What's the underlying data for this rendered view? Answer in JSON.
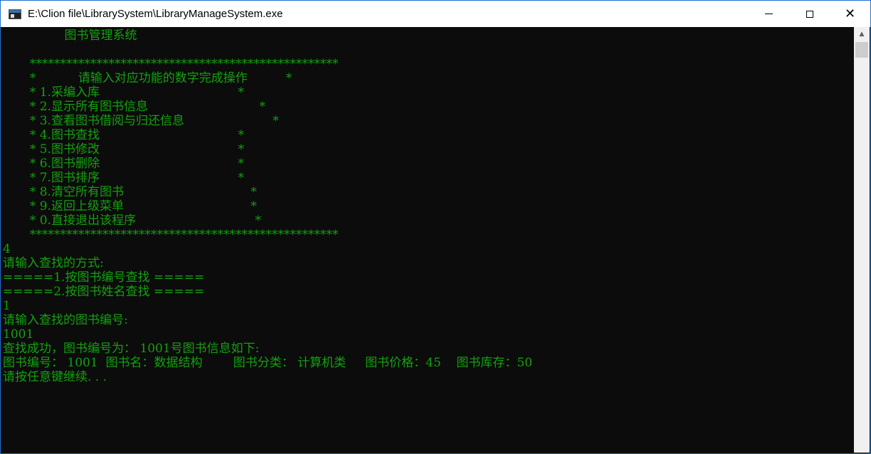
{
  "window": {
    "title": "E:\\Clion file\\LibrarySystem\\LibraryManageSystem.exe",
    "icons": {
      "app": "console-app-icon",
      "minimize": "minimize-icon",
      "maximize": "maximize-icon",
      "close": "close-icon"
    },
    "close_glyph": "✕"
  },
  "console": {
    "text_color": "#13a10e",
    "background": "#0c0c0c",
    "lines": [
      "                图书管理系统",
      "",
      "       ***************************************************",
      "       *           请输入对应功能的数字完成操作          *",
      "       * 1.采编入库                                    *",
      "       * 2.显示所有图书信息                             *",
      "       * 3.查看图书借阅与归还信息                       *",
      "       * 4.图书查找                                    *",
      "       * 5.图书修改                                    *",
      "       * 6.图书删除                                    *",
      "       * 7.图书排序                                    *",
      "       * 8.清空所有图书                                 *",
      "       * 9.返回上级菜单                                 *",
      "       * 0.直接退出该程序                               *",
      "       ***************************************************",
      "4",
      "请输入查找的方式:",
      "=====1.按图书编号查找 =====",
      "=====2.按图书姓名查找 =====",
      "1",
      "请输入查找的图书编号:",
      "1001",
      "查找成功，图书编号为： 1001号图书信息如下:",
      "图书编号： 1001  图书名：数据结构        图书分类： 计算机类     图书价格：45    图书库存：50",
      "请按任意键继续. . ."
    ]
  }
}
